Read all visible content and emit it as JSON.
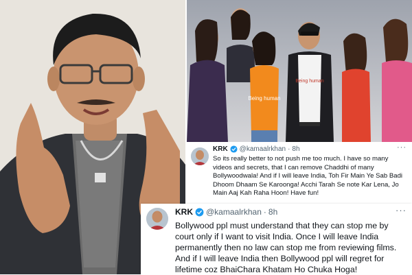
{
  "tweets": [
    {
      "name": "KRK",
      "handle": "@kamaalrkhan",
      "separator": "·",
      "time": "8h",
      "text": "So its really better to not push me too much. I have so many videos and secrets, that I can remove Chaddhi of many Bollywoodwala! And if I will leave India, Toh Fir Main Ye Sab Badi Dhoom Dhaam Se Karoonga! Acchi Tarah Se note Kar Lena, Jo Main Aaj Kah Raha Hoon! Have fun!"
    },
    {
      "name": "KRK",
      "handle": "@kamaalrkhan",
      "separator": "·",
      "time": "8h",
      "text": "Bollywood ppl must understand that they can stop me by court only if I want to visit India. Once I will leave India permanently then no law can stop me from reviewing films. And if I will leave India then Bollywood ppl will regret for lifetime coz BhaiChara Khatam Ho Chuka Hoga!"
    }
  ],
  "photo": {
    "tshirt_text": "Being human"
  },
  "colors": {
    "verified_badge": "#1d9bf0",
    "secondary_text": "#536471",
    "primary_text": "#0f1419",
    "orange_top": "#f28a1d",
    "red_top": "#e0432e"
  },
  "icons": [
    "verified-badge-icon",
    "more-options-icon"
  ]
}
